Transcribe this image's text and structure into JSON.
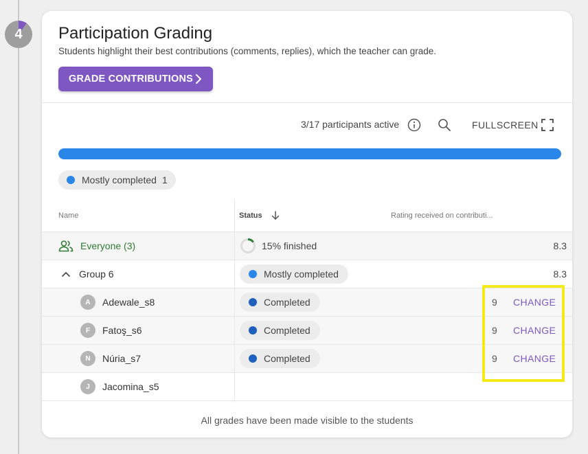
{
  "step": {
    "number": "4",
    "progress_fraction": 0.1
  },
  "card": {
    "title": "Participation Grading",
    "subtitle": "Students highlight their best contributions (comments, replies), which the teacher can grade.",
    "grade_button_label": "GRADE CONTRIBUTIONS"
  },
  "toolbar": {
    "participants_text": "3/17 participants active",
    "fullscreen_label": "FULLSCREEN",
    "icons": [
      "info-icon",
      "search-icon",
      "fullscreen-icon"
    ]
  },
  "progress": {
    "fill_fraction": 1.0,
    "color": "#2a86e8"
  },
  "legend": {
    "label": "Mostly completed",
    "count": "1",
    "color": "#2a86e8"
  },
  "table": {
    "headers": {
      "name": "Name",
      "status": "Status",
      "rating": "Rating received on contributi..."
    },
    "everyone": {
      "label": "Everyone (3)",
      "status": "15% finished",
      "status_fraction": 0.15,
      "rating": "8.3"
    },
    "group": {
      "label": "Group 6",
      "status": "Mostly completed",
      "rating": "8.3"
    },
    "students": [
      {
        "initial": "A",
        "name": "Adewale_s8",
        "status": "Completed",
        "rating": "9",
        "action": "CHANGE"
      },
      {
        "initial": "F",
        "name": "Fatoş_s6",
        "status": "Completed",
        "rating": "9",
        "action": "CHANGE"
      },
      {
        "initial": "N",
        "name": "Núria_s7",
        "status": "Completed",
        "rating": "9",
        "action": "CHANGE"
      },
      {
        "initial": "J",
        "name": "Jacomina_s5",
        "status": "",
        "rating": "",
        "action": ""
      }
    ]
  },
  "footer": {
    "text": "All grades have been made visible to the students"
  },
  "colors": {
    "accent": "#7e57c2",
    "everyone_green": "#2e7d32",
    "mostly_completed": "#2a86e8",
    "completed": "#1f5fbf",
    "highlight": "#f4ea1a"
  }
}
